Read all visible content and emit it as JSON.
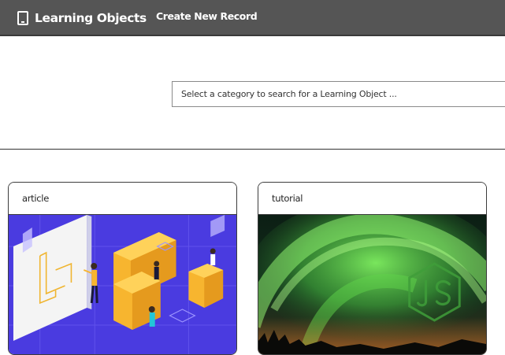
{
  "navbar": {
    "brand": "Learning Objects",
    "brand_icon": "tablet-icon",
    "create_link": "Create New Record",
    "background": "#555555"
  },
  "search": {
    "placeholder": "Select a category to search for a Learning Object ..."
  },
  "cards": [
    {
      "category": "article",
      "image": "isometric-laravel-illustration"
    },
    {
      "category": "tutorial",
      "image": "aurora-nodejs-image"
    }
  ],
  "colors": {
    "article_bg": "#4a3be0",
    "block_yellow": "#f7b52f",
    "aurora_green": "#5fd34a"
  }
}
